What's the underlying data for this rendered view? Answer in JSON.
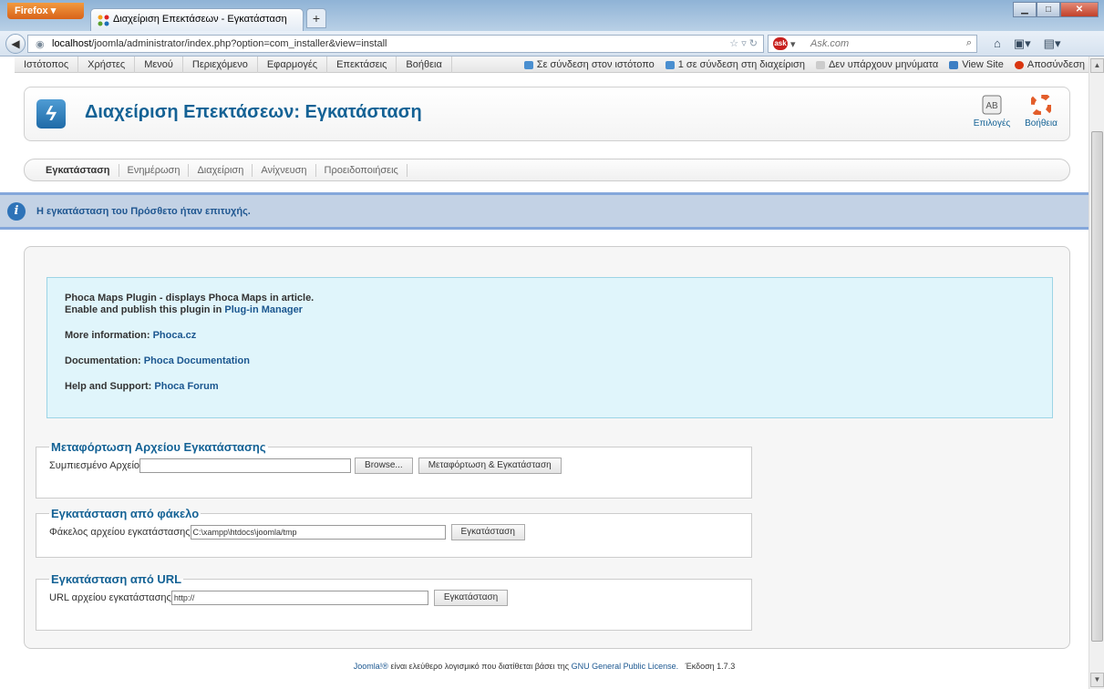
{
  "browser": {
    "app_button": "Firefox",
    "tab_title": "Διαχείριση Επεκτάσεων - Εγκατάσταση",
    "new_tab": "+",
    "url_host": "localhost",
    "url_path": "/joomla/administrator/index.php?option=com_installer&view=install",
    "search_placeholder": "Ask.com",
    "search_logo_text": "ask"
  },
  "admin_menu": {
    "items": [
      "Ιστότοπος",
      "Χρήστες",
      "Μενού",
      "Περιεχόμενο",
      "Εφαρμογές",
      "Επεκτάσεις",
      "Βοήθεια"
    ],
    "status": {
      "site_online": "Σε σύνδεση στον ιστότοπο",
      "admin_online": "1 σε σύνδεση στη διαχείριση",
      "messages": "Δεν υπάρχουν μηνύματα",
      "view_site": "View Site",
      "logout": "Αποσύνδεση"
    }
  },
  "header": {
    "title": "Διαχείριση Επεκτάσεων: Εγκατάσταση",
    "options_label": "Επιλογές",
    "help_label": "Βοήθεια"
  },
  "subnav": [
    "Εγκατάσταση",
    "Ενημέρωση",
    "Διαχείριση",
    "Ανίχνευση",
    "Προειδοποιήσεις"
  ],
  "message": "Η εγκατάσταση του Πρόσθετο ήταν επιτυχής.",
  "plugin_info": {
    "line1": "Phoca Maps Plugin - displays Phoca Maps in article.",
    "line2_prefix": "Enable and publish this plugin in",
    "line2_link": "Plug-in Manager",
    "more_label": "More information:",
    "more_link": "Phoca.cz",
    "doc_label": "Documentation:",
    "doc_link": "Phoca Documentation",
    "help_label": "Help and Support:",
    "help_link": "Phoca Forum"
  },
  "upload": {
    "legend": "Μεταφόρτωση Αρχείου Εγκατάστασης",
    "label": "Συμπιεσμένο Αρχείο",
    "file_value": "",
    "browse": "Browse...",
    "submit": "Μεταφόρτωση & Εγκατάσταση"
  },
  "folder": {
    "legend": "Εγκατάσταση από φάκελο",
    "label": "Φάκελος αρχείου εγκατάστασης",
    "value": "C:\\xampp\\htdocs\\joomla/tmp",
    "submit": "Εγκατάσταση"
  },
  "url_install": {
    "legend": "Εγκατάσταση από URL",
    "label": "URL αρχείου εγκατάστασης",
    "value": "http://",
    "submit": "Εγκατάσταση"
  },
  "footer": {
    "joomla": "Joomla!®",
    "text": "είναι ελεύθερο λογισμικό που διατίθεται βάσει της",
    "license": "GNU General Public License.",
    "version": "Έκδοση 1.7.3"
  },
  "colors": {
    "title_blue": "#146295",
    "message_bg": "#c3d2e5",
    "info_bg": "#e0f5fb"
  }
}
